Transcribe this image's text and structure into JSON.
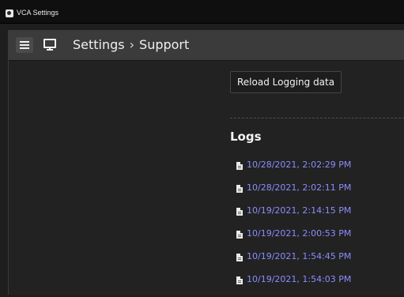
{
  "window": {
    "title": "VCA Settings"
  },
  "header": {
    "breadcrumb": [
      "Settings",
      "Support"
    ],
    "separator": "›",
    "icons": [
      "menu-icon",
      "monitor-icon"
    ]
  },
  "main": {
    "reload_label": "Reload Logging data",
    "logs_title": "Logs",
    "logs": [
      "10/28/2021, 2:02:29 PM",
      "10/28/2021, 2:02:11 PM",
      "10/19/2021, 2:14:15 PM",
      "10/19/2021, 2:00:53 PM",
      "10/19/2021, 1:54:45 PM",
      "10/19/2021, 1:54:03 PM"
    ]
  },
  "colors": {
    "background": "#1e1e1e",
    "header": "#3b3b3b",
    "link": "#8a8dff",
    "text": "#f2f2f2"
  }
}
